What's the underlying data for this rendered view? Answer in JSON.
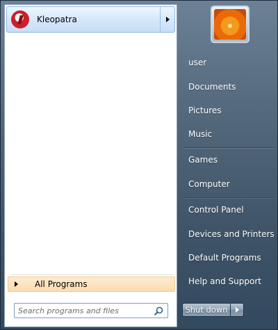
{
  "pinned": {
    "app_label": "Kleopatra"
  },
  "all_programs": {
    "label": "All Programs"
  },
  "search": {
    "placeholder": "Search programs and files"
  },
  "right_pane": {
    "items": [
      {
        "label": "user"
      },
      {
        "label": "Documents"
      },
      {
        "label": "Pictures"
      },
      {
        "label": "Music"
      },
      {
        "label": "Games"
      },
      {
        "label": "Computer"
      },
      {
        "label": "Control Panel"
      },
      {
        "label": "Devices and Printers"
      },
      {
        "label": "Default Programs"
      },
      {
        "label": "Help and Support"
      }
    ]
  },
  "shutdown": {
    "label": "Shut down"
  },
  "icons": {
    "app": "kleopatra-app-icon",
    "user": "user-picture-flower",
    "search": "search-icon",
    "submenu": "chevron-right-icon"
  },
  "colors": {
    "menu_background": "#54687c",
    "pinned_highlight": "#d6e8fb",
    "all_programs_highlight": "#fbdcb1",
    "link_text": "#ffffff"
  }
}
